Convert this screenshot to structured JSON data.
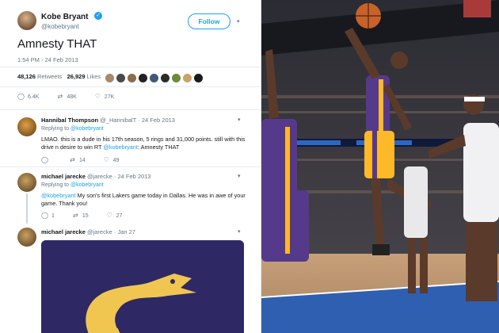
{
  "main_tweet": {
    "name": "Kobe Bryant",
    "handle": "@kobebryant",
    "follow_label": "Follow",
    "text": "Amnesty THAT",
    "time": "1:54 PM - 24 Feb 2013",
    "retweets_count": "48,126",
    "retweets_label": "Retweets",
    "likes_count": "26,929",
    "likes_label": "Likes",
    "actions": {
      "replies": "6.4K",
      "retweets": "48K",
      "likes": "27K"
    }
  },
  "replies": [
    {
      "name": "Hannibal Thompson",
      "handle": "@_HannibalT",
      "date": "· 24 Feb 2013",
      "replying_label": "Replying to",
      "replying_to": "@kobebryant",
      "text_1": "LMAO. this is a dude in his 17th season, 5 rings and 31,000 points. still with this",
      "text_2a": "drive n desire to win RT ",
      "text_2_mention": "@kobebryant",
      "text_2b": ": Amnesty THAT",
      "actions": {
        "replies": "",
        "retweets": "14",
        "likes": "49"
      }
    },
    {
      "name": "michael jarecke",
      "handle": "@jarecke",
      "date": "· 24 Feb 2013",
      "replying_label": "Replying to",
      "replying_to": "@kobebryant",
      "text_mention": "@kobebryant",
      "text_1": " My son's first Lakers game today in Dallas. He was in awe of your",
      "text_2": "game. Thank you!",
      "actions": {
        "replies": "1",
        "retweets": "15",
        "likes": "27"
      }
    },
    {
      "name": "michael jarecke",
      "handle": "@jarecke",
      "date": "· Jan 27"
    }
  ],
  "colors": {
    "twitter_blue": "#1da1f2",
    "lakers_purple": "#552583",
    "lakers_gold": "#fdb927"
  },
  "icons": {
    "verified": "verified-badge-icon",
    "reply": "reply-icon",
    "retweet": "retweet-icon",
    "like": "heart-icon",
    "caret": "chevron-down-icon"
  }
}
